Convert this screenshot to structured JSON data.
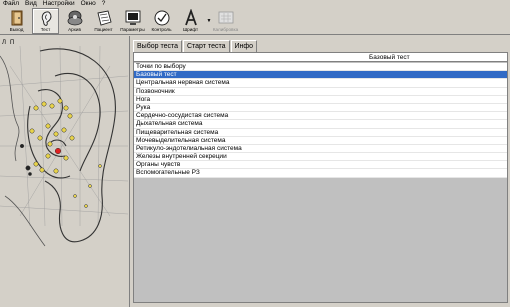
{
  "menu": [
    "Файл",
    "Вид",
    "Настройки",
    "Окно",
    "?"
  ],
  "toolbar": [
    {
      "label": "Выход",
      "icon": "exit-icon"
    },
    {
      "label": "Тест",
      "icon": "ear-icon",
      "active": true
    },
    {
      "label": "Архив",
      "icon": "archive-icon"
    },
    {
      "label": "Пациент",
      "icon": "patient-icon"
    },
    {
      "label": "Параметры",
      "icon": "parameters-icon"
    },
    {
      "label": "Контроль",
      "icon": "control-icon"
    },
    {
      "label": "Шрифт",
      "icon": "font-icon"
    },
    {
      "label": "Калибровка",
      "icon": "calibration-icon",
      "disabled": true
    }
  ],
  "left_panel": {
    "labels": [
      "Л",
      "П"
    ]
  },
  "tabs": [
    "Выбор теста",
    "Старт теста",
    "Инфо"
  ],
  "grid": {
    "column_header": "Базовый тест",
    "rows": [
      "Точки по выбору",
      "Базовый тест",
      "Центральная нервная система",
      "Позвоночник",
      "Нога",
      "Рука",
      "Сердечно-сосудистая система",
      "Дыхательная система",
      "Пищеварительная система",
      "Мочевыделительная система",
      "Ретикуло-эндотелиальная система",
      "Железы внутренней секреции",
      "Органы чувств",
      "Вспомогательные РЗ"
    ],
    "selected_index": 1
  },
  "colors": {
    "selection": "#316ac5",
    "background": "#d4d0c8",
    "grid_empty": "#c0c0c0"
  }
}
